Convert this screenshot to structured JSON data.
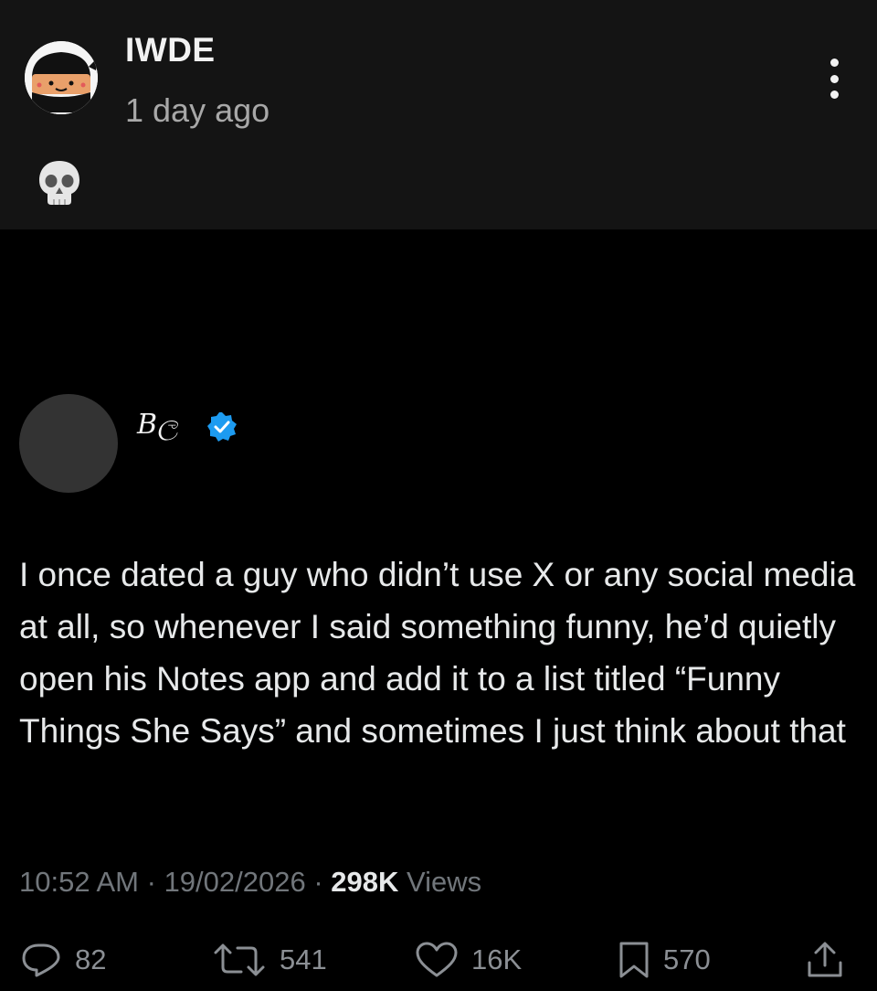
{
  "post": {
    "username": "IWDE",
    "time": "1 day ago",
    "body_emoji_icon": "skull-icon"
  },
  "tweet": {
    "display_name": "Bල",
    "verified": true,
    "text": "I once dated a guy who didn’t use X or any social media at all, so whenever I said something funny, he’d quietly open his Notes app and add it to a list titled “Funny Things She Says” and sometimes I just think about that",
    "time": "10:52 AM",
    "date": "19/02/2026",
    "views_count": "298K",
    "views_label": "Views",
    "separator": "·",
    "actions": {
      "replies": "82",
      "reposts": "541",
      "likes": "16K",
      "bookmarks": "570"
    }
  },
  "colors": {
    "background": "#000000",
    "top_panel": "#141414",
    "verified_badge": "#1d9bf0",
    "muted_text": "#71767b"
  }
}
